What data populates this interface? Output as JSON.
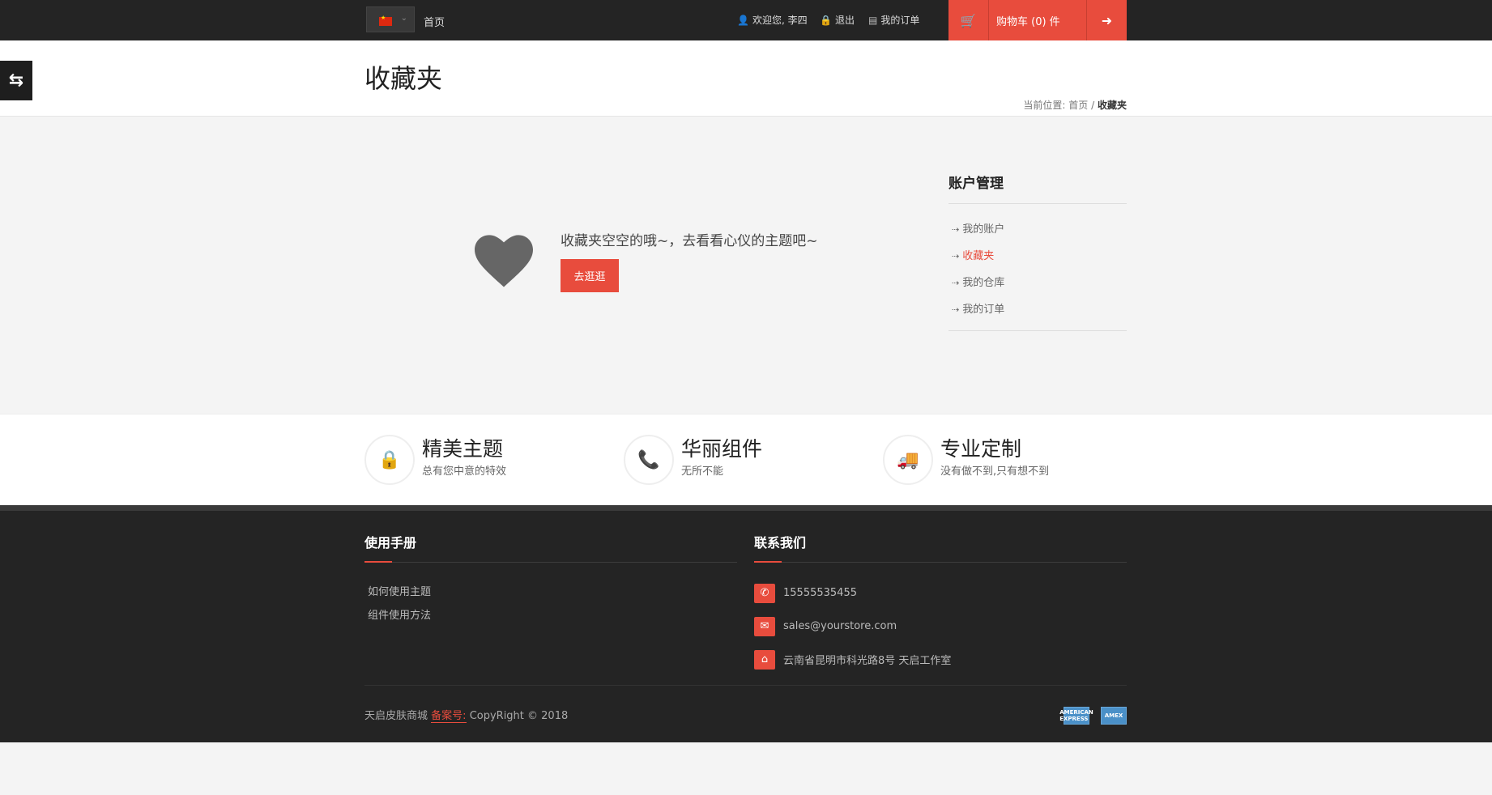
{
  "topbar": {
    "flag": "china-flag",
    "home": "首页",
    "welcome": "欢迎您, 李四",
    "logout": "退出",
    "orders": "我的订单",
    "cart": "购物车 (0) 件"
  },
  "header": {
    "title": "收藏夹",
    "breadcrumb_prefix": "当前位置:",
    "breadcrumb_home": "首页",
    "breadcrumb_sep": "/",
    "breadcrumb_current": "收藏夹"
  },
  "empty_state": {
    "message": "收藏夹空空的哦~，去看看心仪的主题吧~",
    "button": "去逛逛"
  },
  "account_menu": {
    "title": "账户管理",
    "items": [
      {
        "label": "我的账户"
      },
      {
        "label": "收藏夹"
      },
      {
        "label": "我的仓库"
      },
      {
        "label": "我的订单"
      }
    ]
  },
  "features": [
    {
      "title": "精美主题",
      "subtitle": "总有您中意的特效",
      "icon": "lock-icon"
    },
    {
      "title": "华丽组件",
      "subtitle": "无所不能",
      "icon": "phone-icon"
    },
    {
      "title": "专业定制",
      "subtitle": "没有做不到,只有想不到",
      "icon": "truck-icon"
    }
  ],
  "footer": {
    "manual_title": "使用手册",
    "manual_links": [
      "如何使用主题",
      "组件使用方法"
    ],
    "contact_title": "联系我们",
    "phone": "15555535455",
    "email": "sales@yourstore.com",
    "address": "云南省昆明市科光路8号 天启工作室",
    "copyright_store": "天启皮肤商城",
    "beian_label": "备案号:",
    "copyright_text": "CopyRight © 2018",
    "payment_1": "AMERICAN EXPRESS",
    "payment_2": "AMEX"
  },
  "colors": {
    "accent": "#e84c3d",
    "dark": "#242424"
  }
}
